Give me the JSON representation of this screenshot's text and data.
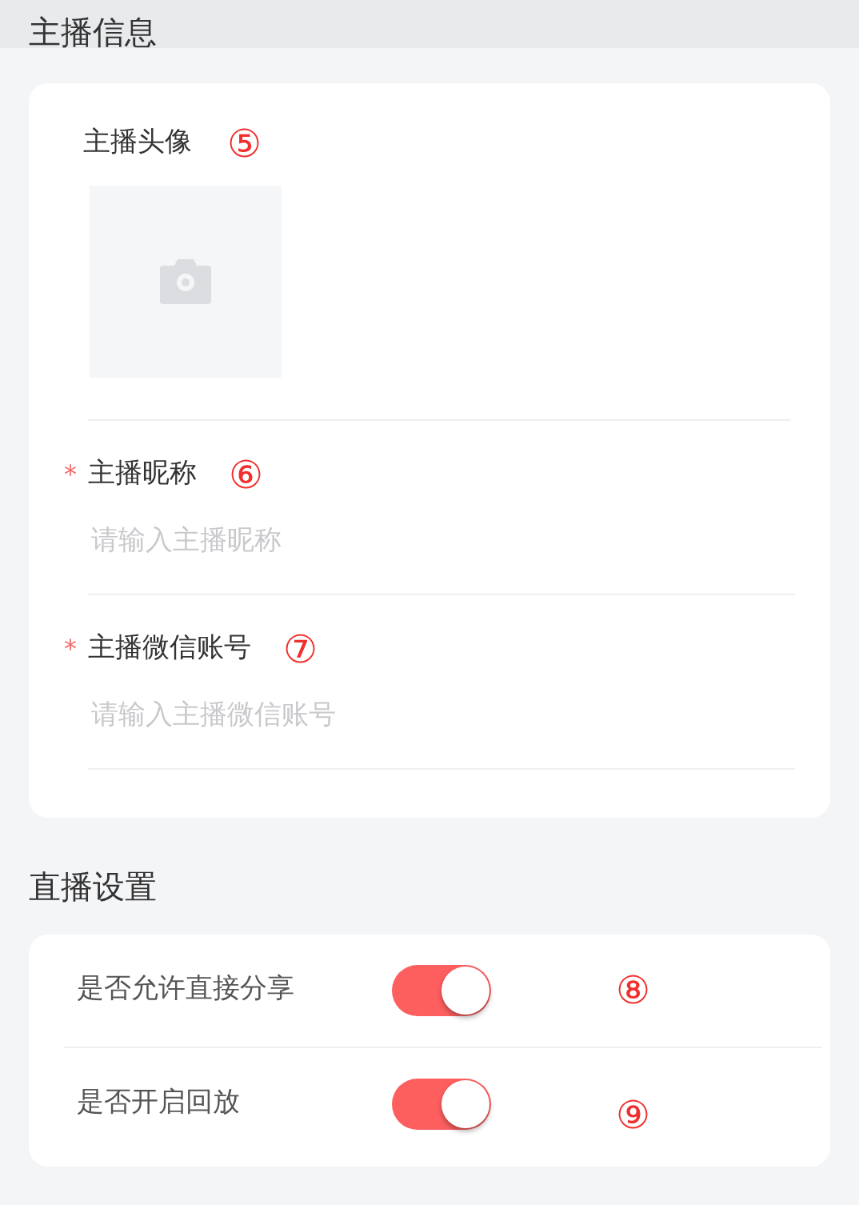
{
  "anchor_section": {
    "title": "主播信息",
    "avatar": {
      "label": "主播头像",
      "marker": "⑤"
    },
    "fields": [
      {
        "label": "主播昵称",
        "required_mark": "*",
        "marker": "⑥",
        "placeholder": "请输入主播昵称"
      },
      {
        "label": "主播微信账号",
        "required_mark": "*",
        "marker": "⑦",
        "placeholder": "请输入主播微信账号"
      }
    ]
  },
  "live_section": {
    "title": "直播设置",
    "settings": [
      {
        "label": "是否允许直接分享",
        "on": true,
        "marker": "⑧"
      },
      {
        "label": "是否开启回放",
        "on": true,
        "marker": "⑨"
      }
    ]
  }
}
